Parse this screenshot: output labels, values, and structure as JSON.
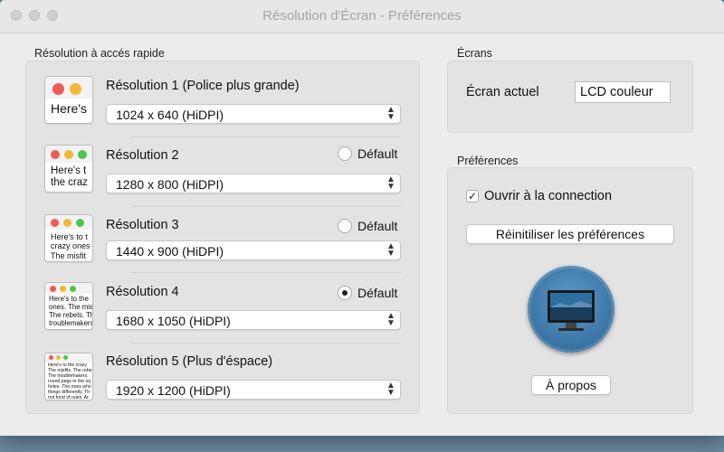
{
  "window": {
    "title": "Résolution d'Écran - Préférences"
  },
  "quick_access": {
    "section_label": "Résolution à accés rapide",
    "resolutions": [
      {
        "title": "Résolution 1 (Police plus grande)",
        "value": "1024 x 640 (HiDPI)",
        "preview_text": "Here's",
        "has_default": false,
        "is_default": false
      },
      {
        "title": "Résolution 2",
        "value": "1280 x 800 (HiDPI)",
        "preview_text": "Here's t\nthe craz",
        "has_default": true,
        "is_default": false
      },
      {
        "title": "Résolution 3",
        "value": "1440 x 900 (HiDPI)",
        "preview_text": "Here's to t\ncrazy ones\nThe misfit",
        "has_default": true,
        "is_default": false
      },
      {
        "title": "Résolution 4",
        "value": "1680 x 1050 (HiDPI)",
        "preview_text": "Here's to the\nones. The mis\nThe rebels. Th\ntroublemakers",
        "has_default": true,
        "is_default": true
      },
      {
        "title": "Résolution 5 (Plus d'éspace)",
        "value": "1920 x 1200 (HiDPI)",
        "preview_text": "Here's to the crazy\nThe misfits. The rebe\nThe troublemakers.\nround pegs in the sq\nholes. The ones who\nthings differently. Th\nnot fond of rules. Ar",
        "has_default": false,
        "is_default": false
      }
    ],
    "default_label": "Défault"
  },
  "screens": {
    "section_label": "Écrans",
    "current_label": "Écran actuel",
    "current_value": "LCD couleur"
  },
  "preferences": {
    "section_label": "Préférences",
    "open_at_login_label": "Ouvrir à la connection",
    "open_at_login_checked": true,
    "reset_button": "Réinitiliser les préférences",
    "about_button": "À propos"
  },
  "colors": {
    "dot_red": "#ee5b55",
    "dot_yellow": "#f4b834",
    "dot_green": "#4fc54a"
  }
}
